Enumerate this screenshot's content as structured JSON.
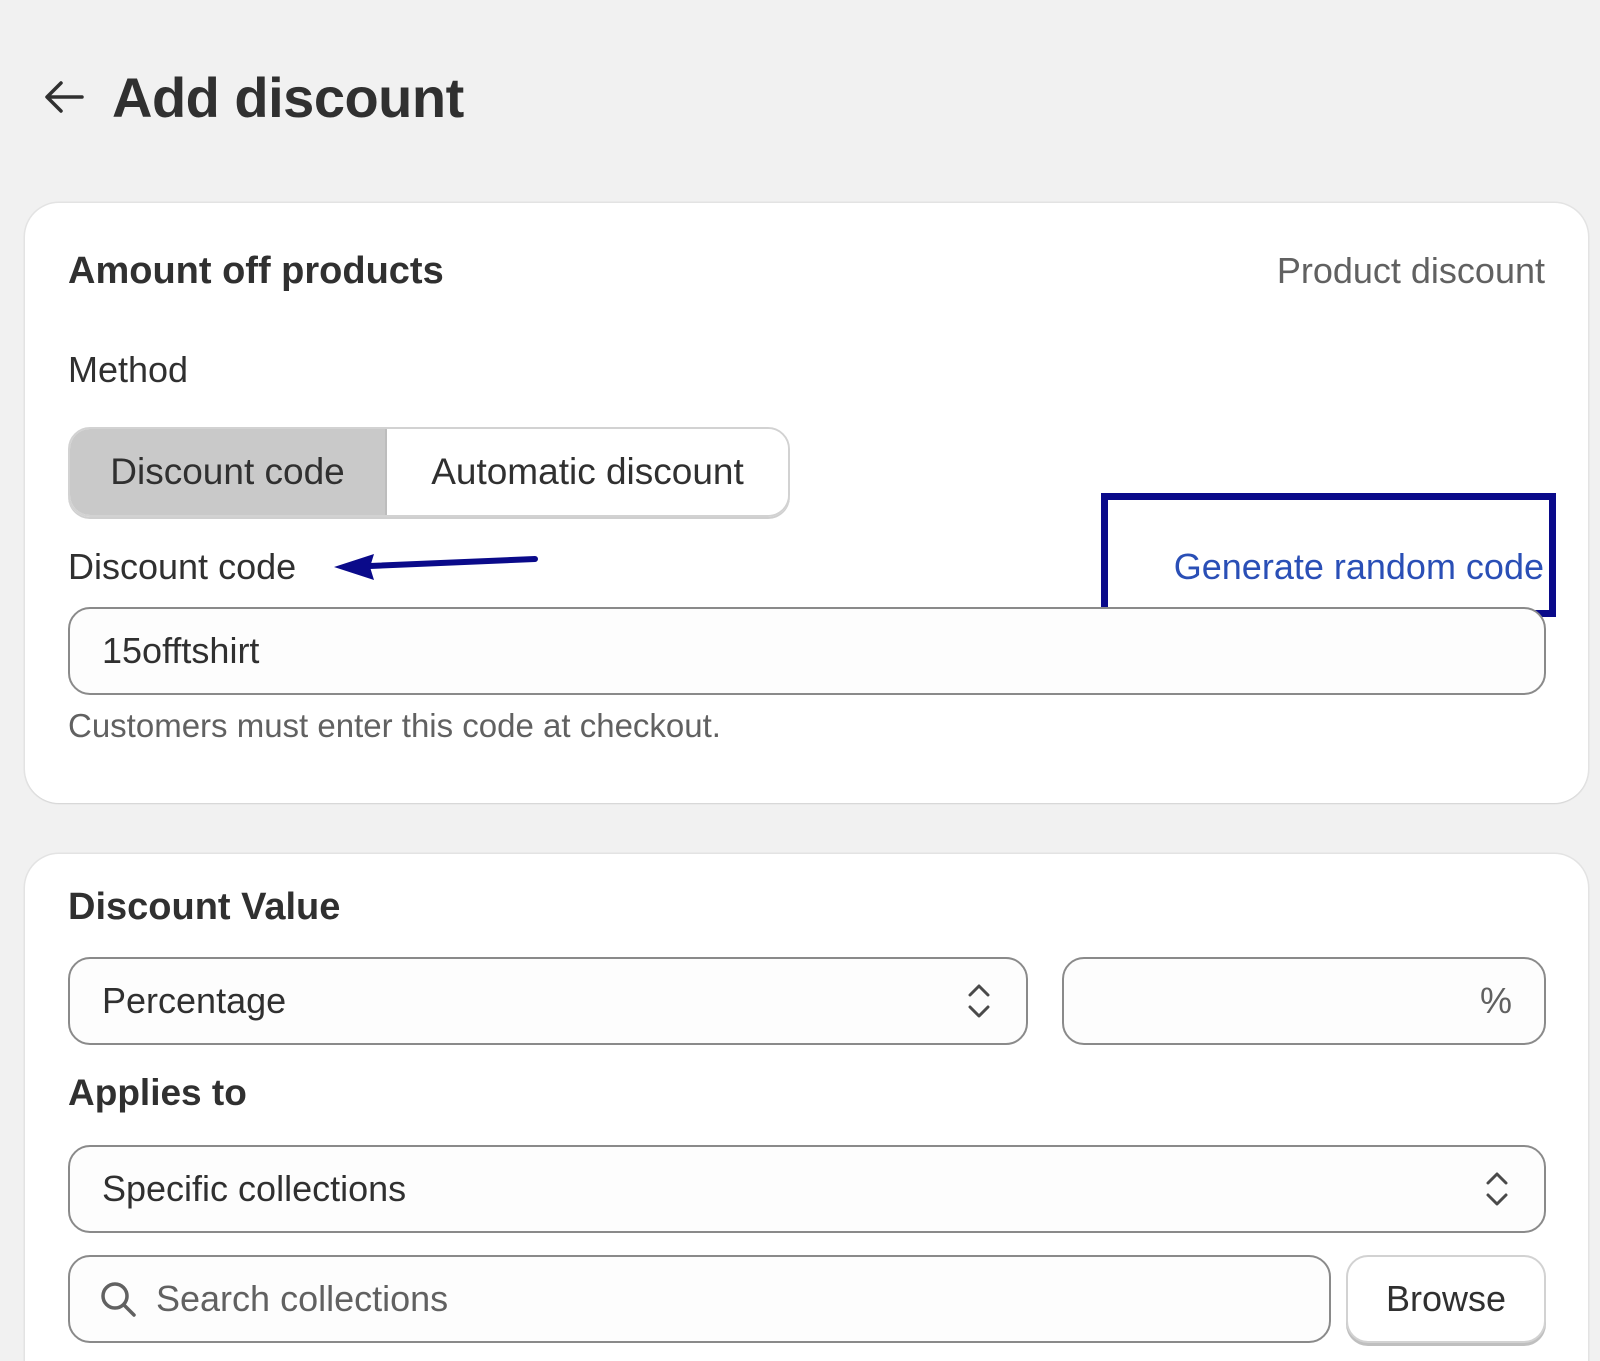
{
  "header": {
    "title": "Add discount",
    "back_icon": "arrow-left-icon"
  },
  "amount_card": {
    "title": "Amount off products",
    "type_tag": "Product discount",
    "method_label": "Method",
    "method_options": [
      "Discount code",
      "Automatic discount"
    ],
    "method_selected": "Discount code",
    "code_label": "Discount code",
    "generate_link": "Generate random code",
    "code_value": "15offtshirt",
    "help_text": "Customers must enter this code at checkout.",
    "annotation_color": "#0a0a8a"
  },
  "value_card": {
    "title": "Discount Value",
    "value_type": "Percentage",
    "value_amount": "",
    "value_suffix": "%",
    "applies_label": "Applies to",
    "applies_value": "Specific collections",
    "search_placeholder": "Search collections",
    "browse_label": "Browse"
  },
  "colors": {
    "background": "#f1f1f1",
    "card": "#ffffff",
    "link": "#2a4fb6",
    "segment_active": "#c9c9c9"
  }
}
